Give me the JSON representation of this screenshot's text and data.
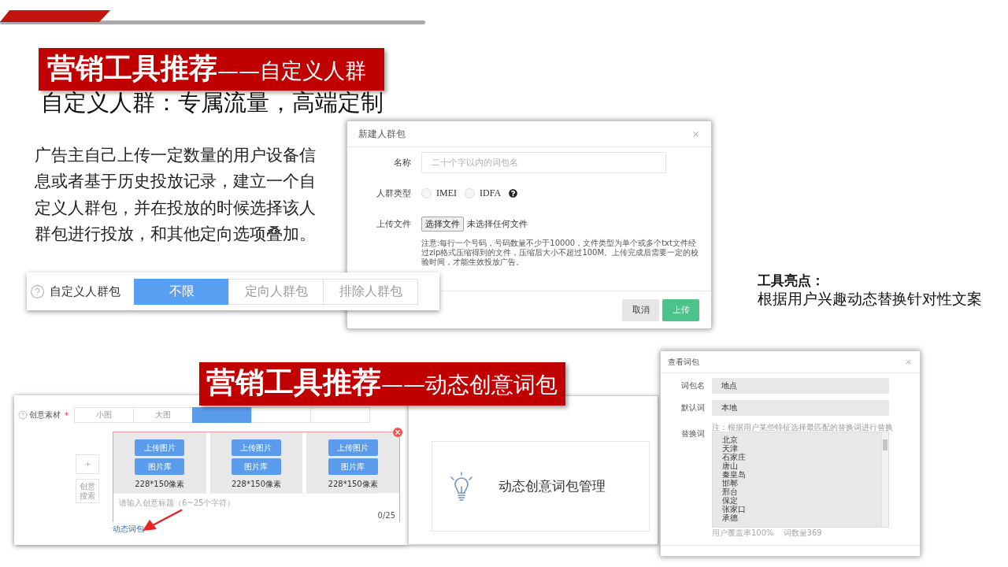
{
  "custom_audience": {
    "banner": {
      "title": "营销工具推荐",
      "subtitle": "——自定义人群"
    },
    "heading": "自定义人群：专属流量，高端定制",
    "description": "广告主自己上传一定数量的用户设备信息或者基于历史投放记录，建立一个自定义人群包，并在投放的时候选择该人群包进行投放，和其他定向选项叠加。",
    "new_audience_dialog": {
      "title": "新建人群包",
      "name_field": {
        "label": "名称",
        "placeholder": "二十个字以内的词包名"
      },
      "audience_type": {
        "label": "人群类型",
        "options": [
          {
            "label": "IMEI",
            "selected": false
          },
          {
            "label": "IDFA",
            "selected": false
          }
        ]
      },
      "upload": {
        "label": "上传文件",
        "button": "选择文件",
        "status": "未选择任何文件",
        "note": "注意:每行一个号码，号码数量不少于10000，文件类型为单个或多个txt文件经过zip格式压缩得到的文件，压缩后大小不超过100M。上传完成后需要一定的校验时间，才能生效投放广告。"
      },
      "buttons": [
        {
          "label": "取消",
          "kind": "secondary"
        },
        {
          "label": "上传",
          "kind": "primary"
        }
      ]
    },
    "audience_selector": {
      "label": "自定义人群包",
      "options": [
        {
          "label": "不限",
          "selected": true
        },
        {
          "label": "定向人群包",
          "selected": false
        },
        {
          "label": "排除人群包",
          "selected": false
        }
      ]
    }
  },
  "highlights": {
    "title": "工具亮点：",
    "text": "根据用户兴趣动态替换针对性文案"
  },
  "dynamic_creative": {
    "banner": {
      "title": "营销工具推荐",
      "subtitle": "——动态创意词包"
    },
    "creative_editor": {
      "label": "创意素材",
      "required_mark": "*",
      "tabs": [
        {
          "label": "小图",
          "selected": false
        },
        {
          "label": "大图",
          "selected": false
        },
        {
          "selected": true
        },
        {
          "selected": false
        },
        {
          "selected": false
        }
      ],
      "search_button": "创意搜索",
      "image_slots": [
        {
          "upload_button": "上传图片",
          "library_button": "图片库",
          "size": "228*150像素"
        },
        {
          "upload_button": "上传图片",
          "library_button": "图片库",
          "size": "228*150像素"
        },
        {
          "upload_button": "上传图片",
          "library_button": "图片库",
          "size": "228*150像素"
        }
      ],
      "title_field": {
        "placeholder": "请输入创意标题（6~25个字符）",
        "counter": "0/25"
      },
      "link": "动态词包"
    },
    "assist_panel": {
      "card": "动态创意词包管理"
    },
    "word_pack_dialog": {
      "title": "查看词包",
      "fields": [
        {
          "label": "词包名",
          "value": "地点"
        },
        {
          "label": "默认词",
          "value": "本地"
        }
      ],
      "replacement": {
        "label": "替换词",
        "note": "注：根据用户某些特征选择最匹配的替换词进行替换",
        "words": [
          "北京",
          "天津",
          "石家庄",
          "唐山",
          "秦皇岛",
          "邯郸",
          "邢台",
          "保定",
          "张家口",
          "承德"
        ]
      },
      "stats": [
        "用户覆盖率100%",
        "词数量369"
      ]
    }
  }
}
